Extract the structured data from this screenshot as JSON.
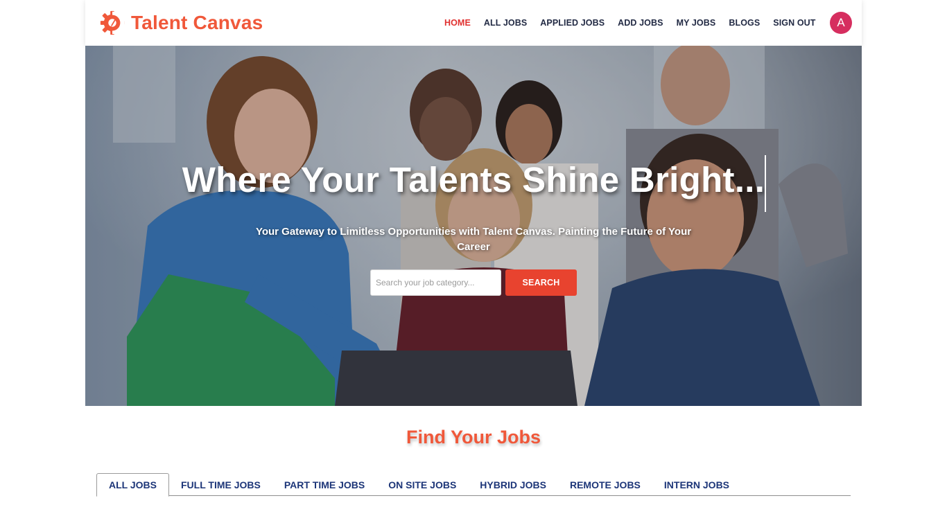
{
  "brand": {
    "name": "Talent Canvas",
    "logo_icon": "gear-brush-logo",
    "color": "#f0583a"
  },
  "nav": {
    "items": [
      {
        "label": "HOME",
        "active": true
      },
      {
        "label": "ALL JOBS"
      },
      {
        "label": "APPLIED JOBS"
      },
      {
        "label": "ADD JOBS"
      },
      {
        "label": "MY JOBS"
      },
      {
        "label": "BLOGS"
      },
      {
        "label": "SIGN OUT"
      }
    ],
    "avatar_initial": "A",
    "avatar_color": "#d62e5f",
    "active_color": "#e0302f"
  },
  "hero": {
    "title": "Where Your Talents Shine Bright...",
    "subtitle": "Your Gateway to Limitless Opportunities with Talent Canvas. Painting the Future of Your Career",
    "search": {
      "placeholder": "Search your job category...",
      "value": "",
      "button_label": "SEARCH",
      "button_color": "#e8432f"
    }
  },
  "jobs_section": {
    "title": "Find Your Jobs",
    "tabs": [
      {
        "label": "ALL JOBS",
        "active": true
      },
      {
        "label": "FULL TIME JOBS"
      },
      {
        "label": "PART TIME JOBS"
      },
      {
        "label": "ON SITE JOBS"
      },
      {
        "label": "HYBRID JOBS"
      },
      {
        "label": "REMOTE JOBS"
      },
      {
        "label": "INTERN JOBS"
      }
    ]
  }
}
